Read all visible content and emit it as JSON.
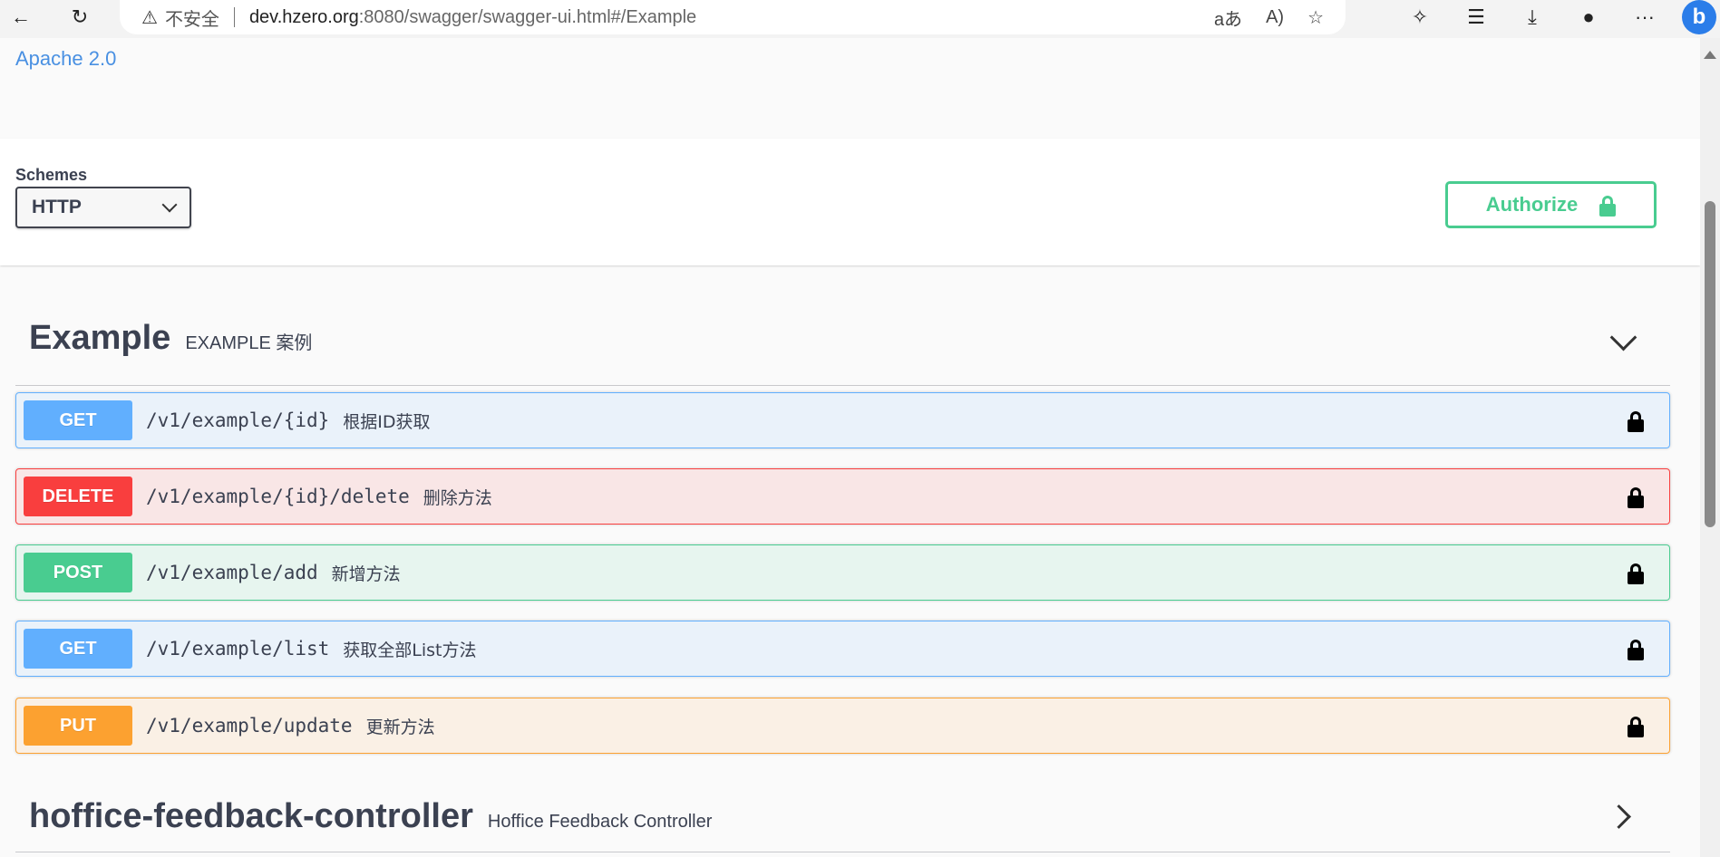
{
  "browser": {
    "security_label": "不安全",
    "url_host": "dev.hzero.org",
    "url_rest": ":8080/swagger/swagger-ui.html#/Example"
  },
  "info": {
    "license": "Apache 2.0"
  },
  "schemes": {
    "label": "Schemes",
    "selected": "HTTP"
  },
  "authorize": {
    "label": "Authorize"
  },
  "tags": [
    {
      "name": "Example",
      "description": "EXAMPLE 案例"
    },
    {
      "name": "hoffice-feedback-controller",
      "description": "Hoffice Feedback Controller"
    }
  ],
  "operations": [
    {
      "method": "GET",
      "path": "/v1/example/{id}",
      "summary": "根据ID获取"
    },
    {
      "method": "DELETE",
      "path": "/v1/example/{id}/delete",
      "summary": "删除方法"
    },
    {
      "method": "POST",
      "path": "/v1/example/add",
      "summary": "新增方法"
    },
    {
      "method": "GET",
      "path": "/v1/example/list",
      "summary": "获取全部List方法"
    },
    {
      "method": "PUT",
      "path": "/v1/example/update",
      "summary": "更新方法"
    }
  ],
  "colors": {
    "get": "#61affe",
    "delete": "#f93e3e",
    "post": "#49cc90",
    "put": "#fca130"
  }
}
